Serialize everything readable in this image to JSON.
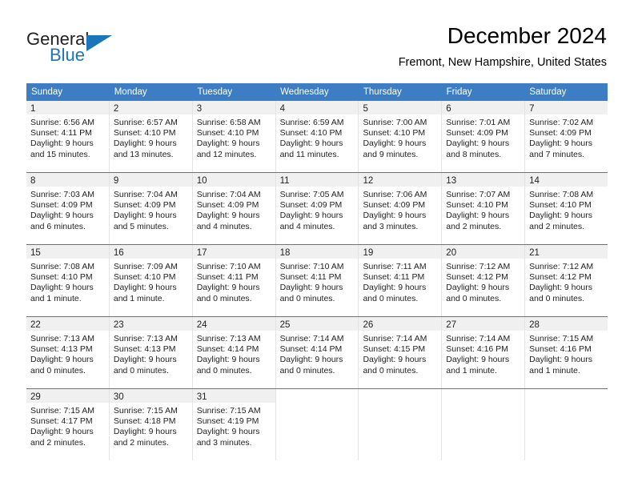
{
  "brand": {
    "name_part1": "General",
    "name_part2": "Blue",
    "flag_icon": "triangle-flag-icon",
    "accent_color": "#1b75bb"
  },
  "header": {
    "title": "December 2024",
    "location": "Fremont, New Hampshire, United States"
  },
  "theme": {
    "header_blue": "#3c7dc4",
    "daynum_band": "#f0f0f0",
    "cell_border": "#e3e3e3",
    "text": "#222222"
  },
  "weekdays": [
    "Sunday",
    "Monday",
    "Tuesday",
    "Wednesday",
    "Thursday",
    "Friday",
    "Saturday"
  ],
  "weeks": [
    [
      {
        "day": "1",
        "sunrise": "Sunrise: 6:56 AM",
        "sunset": "Sunset: 4:11 PM",
        "daylight1": "Daylight: 9 hours",
        "daylight2": "and 15 minutes."
      },
      {
        "day": "2",
        "sunrise": "Sunrise: 6:57 AM",
        "sunset": "Sunset: 4:10 PM",
        "daylight1": "Daylight: 9 hours",
        "daylight2": "and 13 minutes."
      },
      {
        "day": "3",
        "sunrise": "Sunrise: 6:58 AM",
        "sunset": "Sunset: 4:10 PM",
        "daylight1": "Daylight: 9 hours",
        "daylight2": "and 12 minutes."
      },
      {
        "day": "4",
        "sunrise": "Sunrise: 6:59 AM",
        "sunset": "Sunset: 4:10 PM",
        "daylight1": "Daylight: 9 hours",
        "daylight2": "and 11 minutes."
      },
      {
        "day": "5",
        "sunrise": "Sunrise: 7:00 AM",
        "sunset": "Sunset: 4:10 PM",
        "daylight1": "Daylight: 9 hours",
        "daylight2": "and 9 minutes."
      },
      {
        "day": "6",
        "sunrise": "Sunrise: 7:01 AM",
        "sunset": "Sunset: 4:09 PM",
        "daylight1": "Daylight: 9 hours",
        "daylight2": "and 8 minutes."
      },
      {
        "day": "7",
        "sunrise": "Sunrise: 7:02 AM",
        "sunset": "Sunset: 4:09 PM",
        "daylight1": "Daylight: 9 hours",
        "daylight2": "and 7 minutes."
      }
    ],
    [
      {
        "day": "8",
        "sunrise": "Sunrise: 7:03 AM",
        "sunset": "Sunset: 4:09 PM",
        "daylight1": "Daylight: 9 hours",
        "daylight2": "and 6 minutes."
      },
      {
        "day": "9",
        "sunrise": "Sunrise: 7:04 AM",
        "sunset": "Sunset: 4:09 PM",
        "daylight1": "Daylight: 9 hours",
        "daylight2": "and 5 minutes."
      },
      {
        "day": "10",
        "sunrise": "Sunrise: 7:04 AM",
        "sunset": "Sunset: 4:09 PM",
        "daylight1": "Daylight: 9 hours",
        "daylight2": "and 4 minutes."
      },
      {
        "day": "11",
        "sunrise": "Sunrise: 7:05 AM",
        "sunset": "Sunset: 4:09 PM",
        "daylight1": "Daylight: 9 hours",
        "daylight2": "and 4 minutes."
      },
      {
        "day": "12",
        "sunrise": "Sunrise: 7:06 AM",
        "sunset": "Sunset: 4:09 PM",
        "daylight1": "Daylight: 9 hours",
        "daylight2": "and 3 minutes."
      },
      {
        "day": "13",
        "sunrise": "Sunrise: 7:07 AM",
        "sunset": "Sunset: 4:10 PM",
        "daylight1": "Daylight: 9 hours",
        "daylight2": "and 2 minutes."
      },
      {
        "day": "14",
        "sunrise": "Sunrise: 7:08 AM",
        "sunset": "Sunset: 4:10 PM",
        "daylight1": "Daylight: 9 hours",
        "daylight2": "and 2 minutes."
      }
    ],
    [
      {
        "day": "15",
        "sunrise": "Sunrise: 7:08 AM",
        "sunset": "Sunset: 4:10 PM",
        "daylight1": "Daylight: 9 hours",
        "daylight2": "and 1 minute."
      },
      {
        "day": "16",
        "sunrise": "Sunrise: 7:09 AM",
        "sunset": "Sunset: 4:10 PM",
        "daylight1": "Daylight: 9 hours",
        "daylight2": "and 1 minute."
      },
      {
        "day": "17",
        "sunrise": "Sunrise: 7:10 AM",
        "sunset": "Sunset: 4:11 PM",
        "daylight1": "Daylight: 9 hours",
        "daylight2": "and 0 minutes."
      },
      {
        "day": "18",
        "sunrise": "Sunrise: 7:10 AM",
        "sunset": "Sunset: 4:11 PM",
        "daylight1": "Daylight: 9 hours",
        "daylight2": "and 0 minutes."
      },
      {
        "day": "19",
        "sunrise": "Sunrise: 7:11 AM",
        "sunset": "Sunset: 4:11 PM",
        "daylight1": "Daylight: 9 hours",
        "daylight2": "and 0 minutes."
      },
      {
        "day": "20",
        "sunrise": "Sunrise: 7:12 AM",
        "sunset": "Sunset: 4:12 PM",
        "daylight1": "Daylight: 9 hours",
        "daylight2": "and 0 minutes."
      },
      {
        "day": "21",
        "sunrise": "Sunrise: 7:12 AM",
        "sunset": "Sunset: 4:12 PM",
        "daylight1": "Daylight: 9 hours",
        "daylight2": "and 0 minutes."
      }
    ],
    [
      {
        "day": "22",
        "sunrise": "Sunrise: 7:13 AM",
        "sunset": "Sunset: 4:13 PM",
        "daylight1": "Daylight: 9 hours",
        "daylight2": "and 0 minutes."
      },
      {
        "day": "23",
        "sunrise": "Sunrise: 7:13 AM",
        "sunset": "Sunset: 4:13 PM",
        "daylight1": "Daylight: 9 hours",
        "daylight2": "and 0 minutes."
      },
      {
        "day": "24",
        "sunrise": "Sunrise: 7:13 AM",
        "sunset": "Sunset: 4:14 PM",
        "daylight1": "Daylight: 9 hours",
        "daylight2": "and 0 minutes."
      },
      {
        "day": "25",
        "sunrise": "Sunrise: 7:14 AM",
        "sunset": "Sunset: 4:14 PM",
        "daylight1": "Daylight: 9 hours",
        "daylight2": "and 0 minutes."
      },
      {
        "day": "26",
        "sunrise": "Sunrise: 7:14 AM",
        "sunset": "Sunset: 4:15 PM",
        "daylight1": "Daylight: 9 hours",
        "daylight2": "and 0 minutes."
      },
      {
        "day": "27",
        "sunrise": "Sunrise: 7:14 AM",
        "sunset": "Sunset: 4:16 PM",
        "daylight1": "Daylight: 9 hours",
        "daylight2": "and 1 minute."
      },
      {
        "day": "28",
        "sunrise": "Sunrise: 7:15 AM",
        "sunset": "Sunset: 4:16 PM",
        "daylight1": "Daylight: 9 hours",
        "daylight2": "and 1 minute."
      }
    ],
    [
      {
        "day": "29",
        "sunrise": "Sunrise: 7:15 AM",
        "sunset": "Sunset: 4:17 PM",
        "daylight1": "Daylight: 9 hours",
        "daylight2": "and 2 minutes."
      },
      {
        "day": "30",
        "sunrise": "Sunrise: 7:15 AM",
        "sunset": "Sunset: 4:18 PM",
        "daylight1": "Daylight: 9 hours",
        "daylight2": "and 2 minutes."
      },
      {
        "day": "31",
        "sunrise": "Sunrise: 7:15 AM",
        "sunset": "Sunset: 4:19 PM",
        "daylight1": "Daylight: 9 hours",
        "daylight2": "and 3 minutes."
      },
      {
        "day": "",
        "sunrise": "",
        "sunset": "",
        "daylight1": "",
        "daylight2": ""
      },
      {
        "day": "",
        "sunrise": "",
        "sunset": "",
        "daylight1": "",
        "daylight2": ""
      },
      {
        "day": "",
        "sunrise": "",
        "sunset": "",
        "daylight1": "",
        "daylight2": ""
      },
      {
        "day": "",
        "sunrise": "",
        "sunset": "",
        "daylight1": "",
        "daylight2": ""
      }
    ]
  ]
}
